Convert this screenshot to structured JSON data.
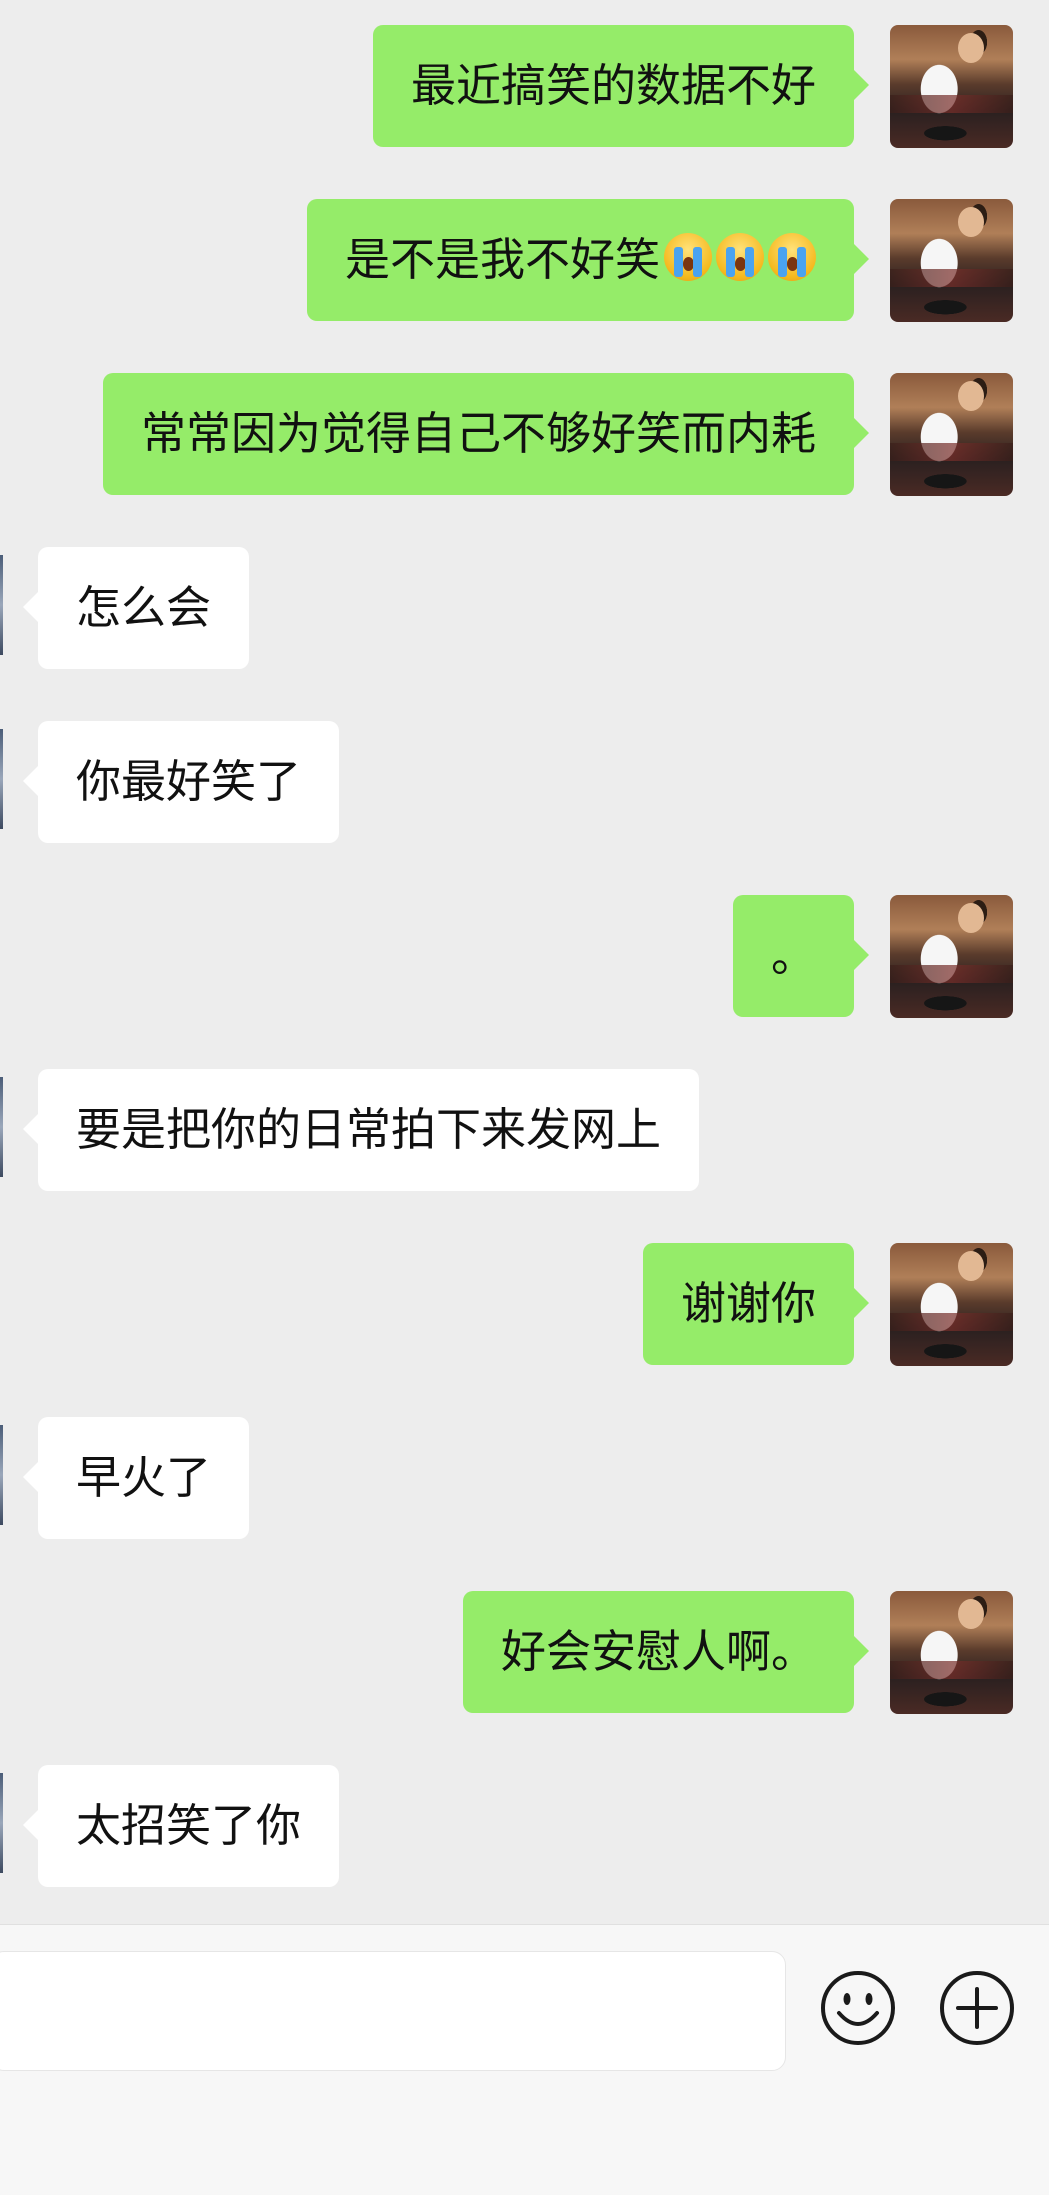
{
  "chat": {
    "messages": [
      {
        "side": "out",
        "text": "最近搞笑的数据不好"
      },
      {
        "side": "out",
        "text": "是不是我不好笑",
        "emoji": [
          "loudly-crying-face-emoji",
          "loudly-crying-face-emoji",
          "loudly-crying-face-emoji"
        ]
      },
      {
        "side": "out",
        "text": "常常因为觉得自己不够好笑而内耗"
      },
      {
        "side": "in",
        "text": "怎么会"
      },
      {
        "side": "in",
        "text": "你最好笑了"
      },
      {
        "side": "out",
        "text": "。"
      },
      {
        "side": "in",
        "text": "要是把你的日常拍下来发网上"
      },
      {
        "side": "out",
        "text": "谢谢你"
      },
      {
        "side": "in",
        "text": "早火了"
      },
      {
        "side": "out",
        "text": "好会安慰人啊。"
      },
      {
        "side": "in",
        "text": "太招笑了你"
      }
    ]
  },
  "input_bar": {
    "draft": "",
    "icons": [
      "emoji-icon",
      "plus-icon"
    ]
  },
  "colors": {
    "outgoing_bubble": "#95ec69",
    "incoming_bubble": "#ffffff",
    "background": "#ededed"
  }
}
